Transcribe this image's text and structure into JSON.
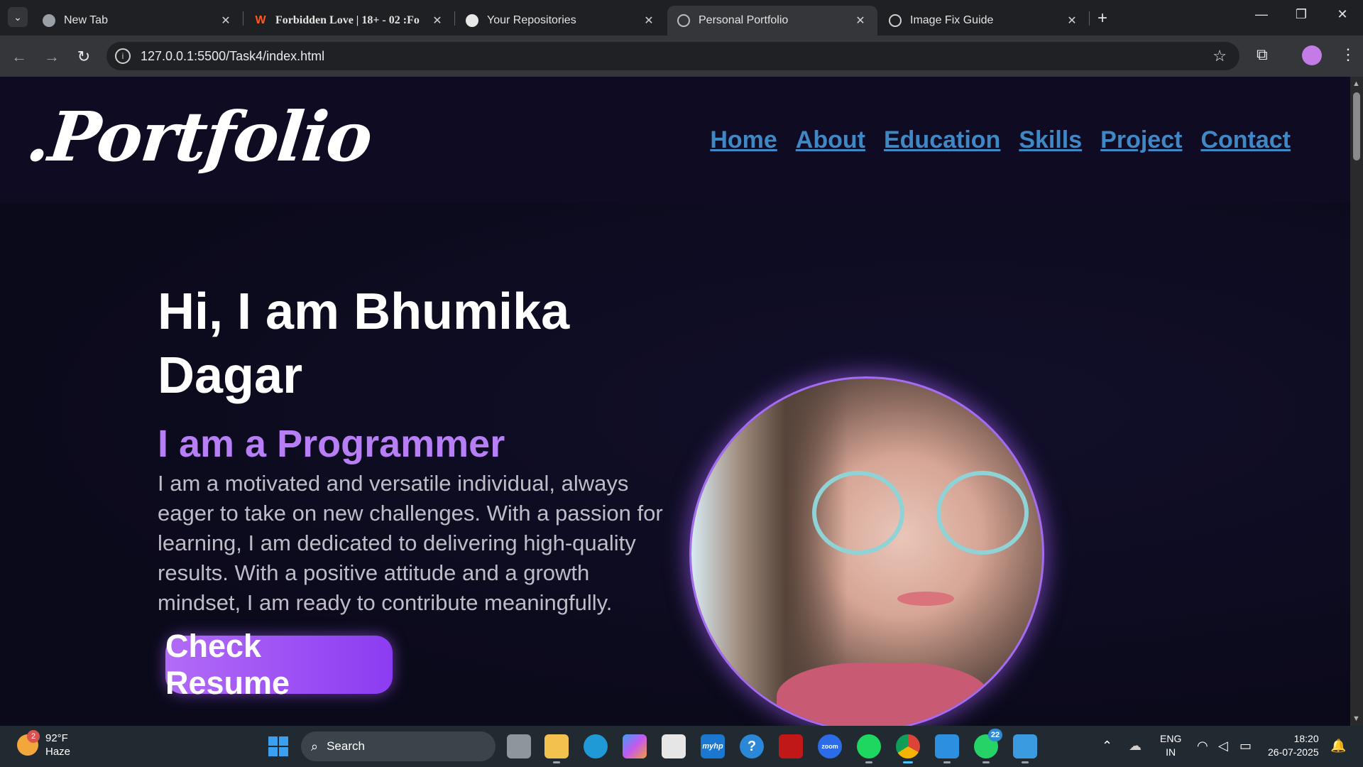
{
  "browser": {
    "tabs": [
      {
        "label": "New Tab",
        "active": false
      },
      {
        "label": "Forbidden Love | 18+ - 02 :Fo",
        "active": false
      },
      {
        "label": "Your Repositories",
        "active": false
      },
      {
        "label": "Personal Portfolio",
        "active": true
      },
      {
        "label": "Image Fix Guide",
        "active": false
      }
    ],
    "new_tab_glyph": "+",
    "url": "127.0.0.1:5500/Task4/index.html"
  },
  "site": {
    "logo": ".Portfolio",
    "nav": [
      "Home",
      "About",
      "Education",
      "Skills",
      "Project",
      "Contact"
    ],
    "hero": {
      "greeting": "Hi, I am Bhumika Dagar",
      "role": "I am a Programmer",
      "description": "I am a motivated and versatile individual, always eager to take on new challenges. With a passion for learning, I am dedicated to delivering high-quality results. With a positive attitude and a growth mindset, I am ready to contribute meaningfully.",
      "cta": "Check Resume"
    }
  },
  "taskbar": {
    "weather": {
      "temp": "92°F",
      "condition": "Haze",
      "badge": "2"
    },
    "search_placeholder": "Search",
    "language": {
      "line1": "ENG",
      "line2": "IN"
    },
    "time": "18:20",
    "date": "26-07-2025",
    "whatsapp_badge": "22",
    "myhp_label": "myhp",
    "zoom_label": "zoom"
  },
  "colors": {
    "nav_link": "#3f88c5",
    "accent_purple": "#b77ef5",
    "page_bg": "#0c0a1d"
  }
}
